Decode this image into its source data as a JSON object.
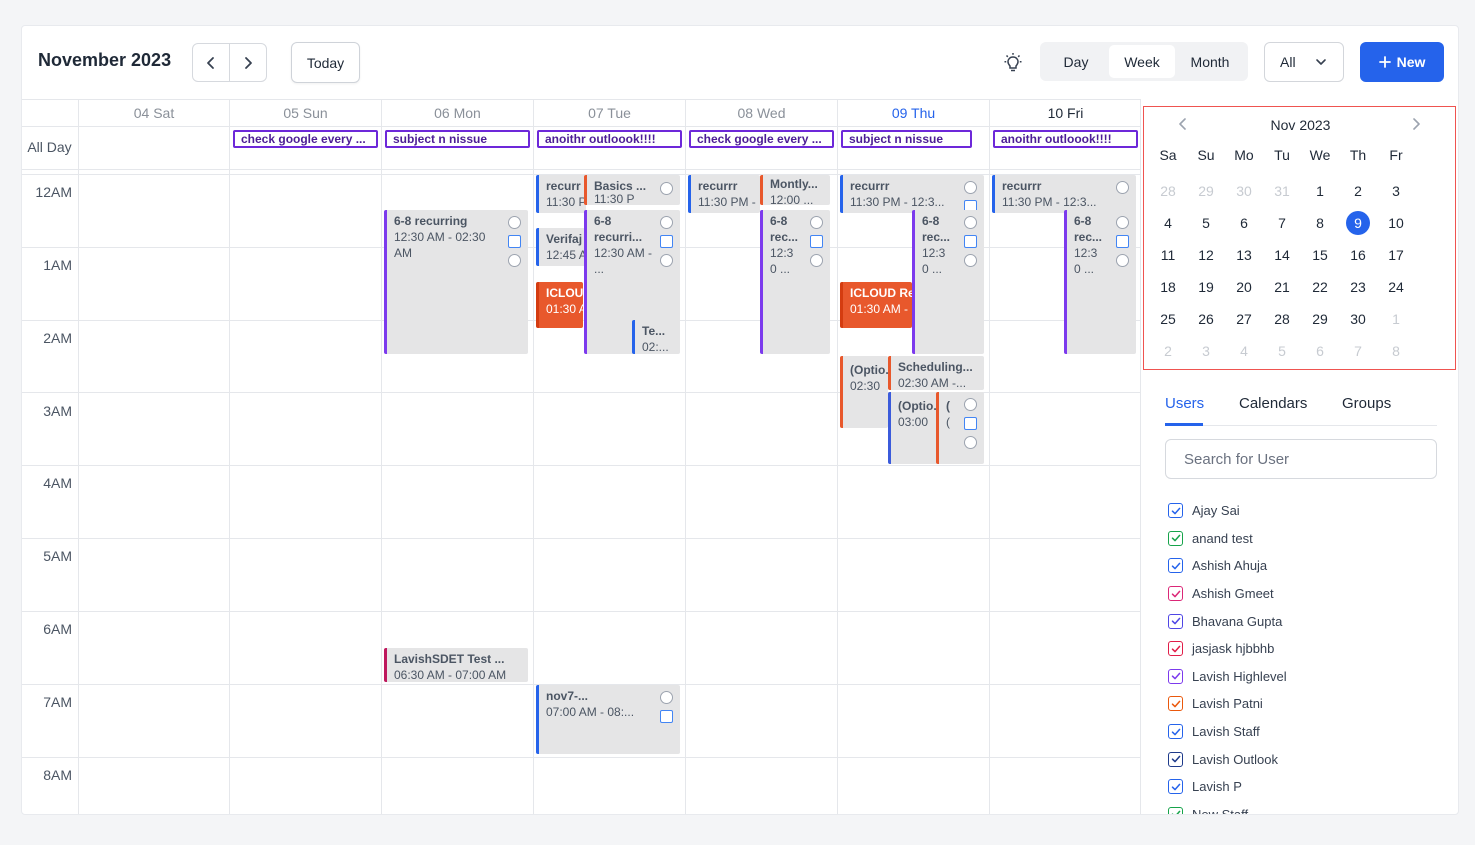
{
  "header": {
    "month_title": "November 2023",
    "today_label": "Today",
    "views": [
      "Day",
      "Week",
      "Month"
    ],
    "active_view": "Week",
    "filter_value": "All",
    "new_label": "New"
  },
  "calendar": {
    "all_day_label": "All Day",
    "days": [
      "04 Sat",
      "05 Sun",
      "06 Mon",
      "07 Tue",
      "08 Wed",
      "09 Thu",
      "10 Fri"
    ],
    "today_index": 5,
    "hours": [
      "12AM",
      "1AM",
      "2AM",
      "3AM",
      "4AM",
      "5AM",
      "6AM",
      "7AM",
      "8AM"
    ],
    "all_day_events": [
      {
        "day": 1,
        "title": "check google every ..."
      },
      {
        "day": 2,
        "title": "subject n nissue"
      },
      {
        "day": 3,
        "title": "anoithr outloook!!!!"
      },
      {
        "day": 4,
        "title": "check google every ..."
      },
      {
        "day": 5,
        "title": "subject n nissue"
      },
      {
        "day": 6,
        "title": "anoithr outloook!!!!"
      }
    ],
    "events": [
      {
        "id": "e1",
        "title": "6-8 recurring",
        "time": "12:30 AM - 02:30 AM",
        "color": "#7c3aed"
      },
      {
        "id": "e2",
        "title": "LavishSDET Test ...",
        "time": "06:30 AM - 07:00 AM",
        "color": "#be185d"
      },
      {
        "id": "e3",
        "title": "recurr",
        "time": "11:30 P",
        "color": "#2563eb"
      },
      {
        "id": "e4",
        "title": "Basics ...",
        "time": "11:30 P",
        "color": "#e8582c"
      },
      {
        "id": "e5",
        "title": "Verifaj",
        "time": "12:45 A",
        "color": "#2563eb"
      },
      {
        "id": "e6",
        "title": "6-8 recurri...",
        "time": "12:30 AM - ...",
        "color": "#7c3aed"
      },
      {
        "id": "e7",
        "title": "ICLOU",
        "time": "01:30 A",
        "color": "#d43c10"
      },
      {
        "id": "e8",
        "title": "Te...",
        "time": "02:...",
        "color": "#2563eb"
      },
      {
        "id": "e9",
        "title": "nov7-...",
        "time": "07:00 AM - 08:...",
        "color": "#2563eb"
      },
      {
        "id": "e10",
        "title": "recurrr",
        "time": "11:30 PM -",
        "color": "#2563eb"
      },
      {
        "id": "e11",
        "title": "Montly...",
        "time": "12:00 ...",
        "color": "#e8582c"
      },
      {
        "id": "e12",
        "title": "6-8 rec...",
        "time": "12:3 0 ...",
        "color": "#7c3aed"
      },
      {
        "id": "e13",
        "title": "recurrr",
        "time": "11:30 PM - 12:3...",
        "color": "#2563eb"
      },
      {
        "id": "e14",
        "title": "6-8 rec...",
        "time": "12:3 0 ...",
        "color": "#7c3aed"
      },
      {
        "id": "e15",
        "title": "ICLOUD Re",
        "time": "01:30 AM -",
        "color": "#d43c10"
      },
      {
        "id": "e16",
        "title": "(Optio...",
        "time": "02:30",
        "color": "#e8582c"
      },
      {
        "id": "e17",
        "title": "Scheduling...",
        "time": "02:30 AM -...",
        "color": "#e8582c"
      },
      {
        "id": "e18",
        "title": "(Optio...",
        "time": "03:00",
        "color": "#3b5bdb"
      },
      {
        "id": "e19",
        "title": "(",
        "time": "(",
        "color": "#e8582c"
      },
      {
        "id": "e20",
        "title": "recurrr",
        "time": "11:30 PM - 12:3...",
        "color": "#2563eb"
      },
      {
        "id": "e21",
        "title": "6-8 rec...",
        "time": "12:3 0 ...",
        "color": "#7c3aed"
      }
    ]
  },
  "mini_calendar": {
    "title": "Nov 2023",
    "weekdays": [
      "Sa",
      "Su",
      "Mo",
      "Tu",
      "We",
      "Th",
      "Fr"
    ],
    "weeks": [
      [
        "28",
        "29",
        "30",
        "31",
        "1",
        "2",
        "3"
      ],
      [
        "4",
        "5",
        "6",
        "7",
        "8",
        "9",
        "10"
      ],
      [
        "11",
        "12",
        "13",
        "14",
        "15",
        "16",
        "17"
      ],
      [
        "18",
        "19",
        "20",
        "21",
        "22",
        "23",
        "24"
      ],
      [
        "25",
        "26",
        "27",
        "28",
        "29",
        "30",
        "1"
      ],
      [
        "2",
        "3",
        "4",
        "5",
        "6",
        "7",
        "8"
      ]
    ],
    "selected": "9"
  },
  "sidebar": {
    "tabs": [
      "Users",
      "Calendars",
      "Groups"
    ],
    "active_tab": "Users",
    "search_placeholder": "Search for User",
    "users": [
      {
        "name": "Ajay Sai",
        "color": "#2563eb"
      },
      {
        "name": "anand test",
        "color": "#16a34a"
      },
      {
        "name": "Ashish Ahuja",
        "color": "#2563eb"
      },
      {
        "name": "Ashish Gmeet",
        "color": "#db2777"
      },
      {
        "name": "Bhavana Gupta",
        "color": "#4f46e5"
      },
      {
        "name": "jasjask hjbbhb",
        "color": "#e11d48"
      },
      {
        "name": "Lavish Highlevel",
        "color": "#7c3aed"
      },
      {
        "name": "Lavish Patni",
        "color": "#ea580c"
      },
      {
        "name": "Lavish Staff",
        "color": "#2563eb"
      },
      {
        "name": "Lavish Outlook",
        "color": "#1e3a8a"
      },
      {
        "name": "Lavish P",
        "color": "#2563eb"
      },
      {
        "name": "New Staff",
        "color": "#16a34a"
      }
    ]
  }
}
